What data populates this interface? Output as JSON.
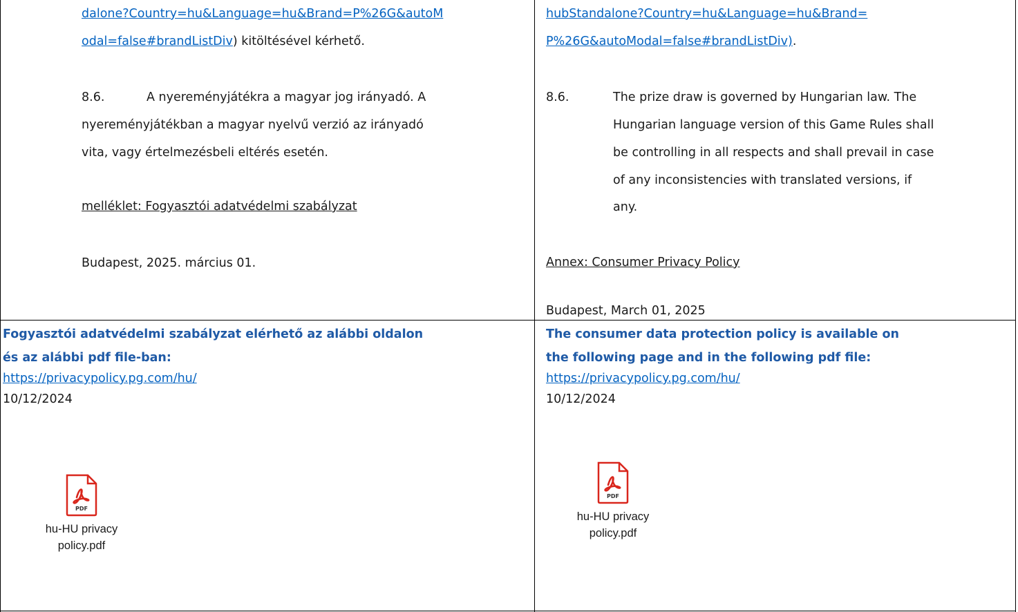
{
  "left": {
    "link_line1": "dalone?Country=hu&Language=hu&Brand=P%26G&autoM",
    "link_line2": "odal=false#brandListDiv",
    "after_link": ") kitöltésével kérhető.",
    "section_num": "8.6.",
    "section_l1": "A nyereményjátékra a magyar jog irányadó. A",
    "section_l2": "nyereményjátékban a magyar nyelvű verzió az irányadó",
    "section_l3": "vita, vagy értelmezésbeli eltérés esetén.",
    "annex": "melléklet: Fogyasztói adatvédelmi szabályzat",
    "date": "Budapest, 2025. március 01.",
    "policy_heading_l1": "Fogyasztói adatvédelmi szabályzat elérhető az alábbi oldalon",
    "policy_heading_l2": "és az alábbi pdf file-ban:",
    "policy_url": "https://privacypolicy.pg.com/hu/",
    "policy_date": "10/12/2024",
    "pdf_label_l1": "hu-HU privacy",
    "pdf_label_l2": "policy.pdf"
  },
  "right": {
    "link_line1": "hubStandalone?Country=hu&Language=hu&Brand=",
    "link_line2": "P%26G&autoModal=false#brandListDiv)",
    "after_link": ".",
    "section_num": "8.6.",
    "section_l1": "The prize draw is governed by Hungarian law. The",
    "section_l2": "Hungarian language version of this Game Rules shall",
    "section_l3": "be controlling in all respects and shall prevail in case",
    "section_l4": "of any inconsistencies with translated versions, if",
    "section_l5": "any.",
    "annex": "Annex: Consumer Privacy Policy",
    "date": "Budapest, March 01, 2025",
    "policy_heading_l1": "The consumer data protection policy is available on",
    "policy_heading_l2": "the following page and in the following pdf file:",
    "policy_url": "https://privacypolicy.pg.com/hu/",
    "policy_date": "10/12/2024",
    "pdf_label_l1": "hu-HU privacy",
    "pdf_label_l2": "policy.pdf"
  },
  "icons": {
    "pdf": "pdf-file-icon",
    "pdf_badge": "PDF"
  },
  "colors": {
    "link": "#0563c1",
    "heading": "#1f5aa6",
    "pdf_red": "#d9261c"
  }
}
